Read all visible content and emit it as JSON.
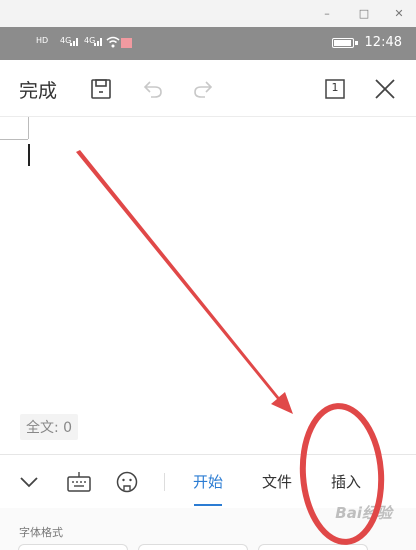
{
  "window": {
    "minimize": "–",
    "maximize": "□",
    "close": "✕"
  },
  "status_bar": {
    "sim1": "HD",
    "sim2": "HD",
    "net1": "4G",
    "net2": "4G",
    "time": "12:48"
  },
  "toolbar": {
    "done_label": "完成",
    "icons": [
      "save-icon",
      "undo-icon",
      "redo-icon",
      "page-count-icon",
      "close-icon"
    ],
    "page_count": "1"
  },
  "editor": {
    "word_count": "全文: 0"
  },
  "bottom_bar": {
    "icons": [
      "collapse-chevron-icon",
      "keyboard-icon",
      "voice-icon"
    ],
    "tabs": [
      {
        "label": "开始",
        "active": true
      },
      {
        "label": "文件",
        "active": false
      },
      {
        "label": "插入",
        "active": false
      }
    ]
  },
  "format_panel": {
    "section_label": "字体格式"
  },
  "annotation": {
    "color": "#e03c3c"
  },
  "watermark": "Bai经验",
  "colors": {
    "accent": "#2b7cd3",
    "status_bar": "#8c8c8c"
  }
}
